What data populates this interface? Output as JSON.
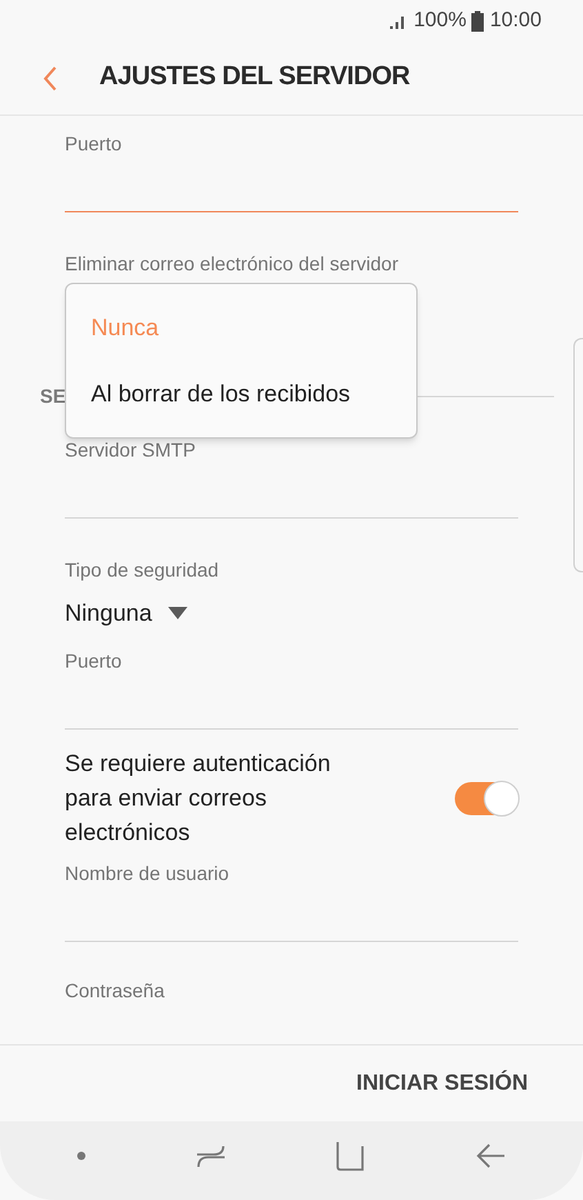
{
  "status_bar": {
    "battery": "100%",
    "time": "10:00"
  },
  "header": {
    "title": "AJUSTES DEL SERVIDOR"
  },
  "items": [
    {
      "kind": "field",
      "label": "Puerto",
      "focused": true
    },
    {
      "kind": "select",
      "label": "Eliminar correo electrónico del servidor"
    },
    {
      "kind": "section",
      "label": "SE"
    },
    {
      "kind": "field",
      "label": "Servidor SMTP",
      "focused": false
    },
    {
      "kind": "select",
      "label": "Tipo de seguridad",
      "value": "Ninguna"
    },
    {
      "kind": "field",
      "label": "Puerto",
      "focused": false
    },
    {
      "kind": "toggle",
      "label": "Se requiere autenticación para enviar correos electrónicos",
      "on": true
    },
    {
      "kind": "field",
      "label": "Nombre de usuario",
      "focused": false
    },
    {
      "kind": "label",
      "label": "Contraseña"
    }
  ],
  "dropdown": {
    "options": [
      {
        "label": "Nunca",
        "selected": true
      },
      {
        "label": "Al borrar de los recibidos",
        "selected": false
      }
    ]
  },
  "footer": {
    "button": "INICIAR SESIÓN"
  }
}
